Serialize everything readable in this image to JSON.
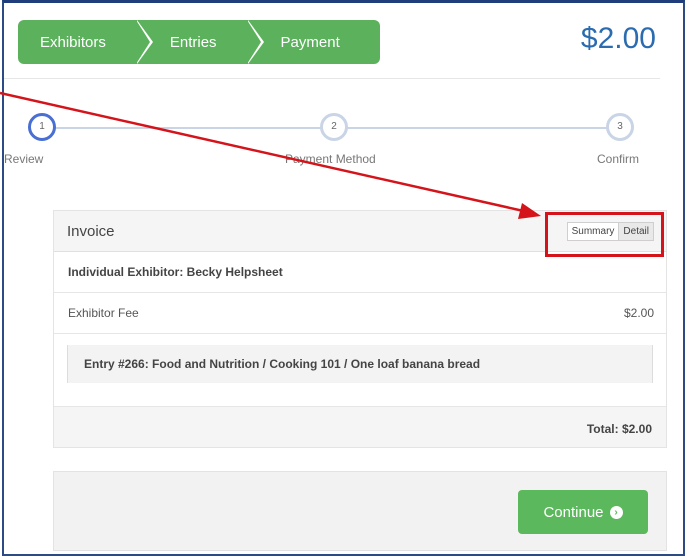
{
  "breadcrumb": [
    "Exhibitors",
    "Entries",
    "Payment"
  ],
  "header": {
    "amount": "$2.00"
  },
  "steps": [
    {
      "number": "1",
      "label": "Review"
    },
    {
      "number": "2",
      "label": "Payment Method"
    },
    {
      "number": "3",
      "label": "Confirm"
    }
  ],
  "invoice": {
    "title": "Invoice",
    "toggle_summary": "Summary",
    "toggle_detail": "Detail",
    "exhibitor": "Individual Exhibitor: Becky Helpsheet",
    "fee_label": "Exhibitor Fee",
    "fee_amount": "$2.00",
    "entry": "Entry #266: Food and Nutrition / Cooking 101 / One loaf banana bread",
    "total": "Total: $2.00"
  },
  "footer": {
    "continue_label": "Continue"
  },
  "colors": {
    "accent_green": "#5cb85c",
    "highlight_red": "#d4141a",
    "amount_blue": "#2b6cb0"
  },
  "icons": {
    "continue": "arrow-circle-right-icon"
  }
}
